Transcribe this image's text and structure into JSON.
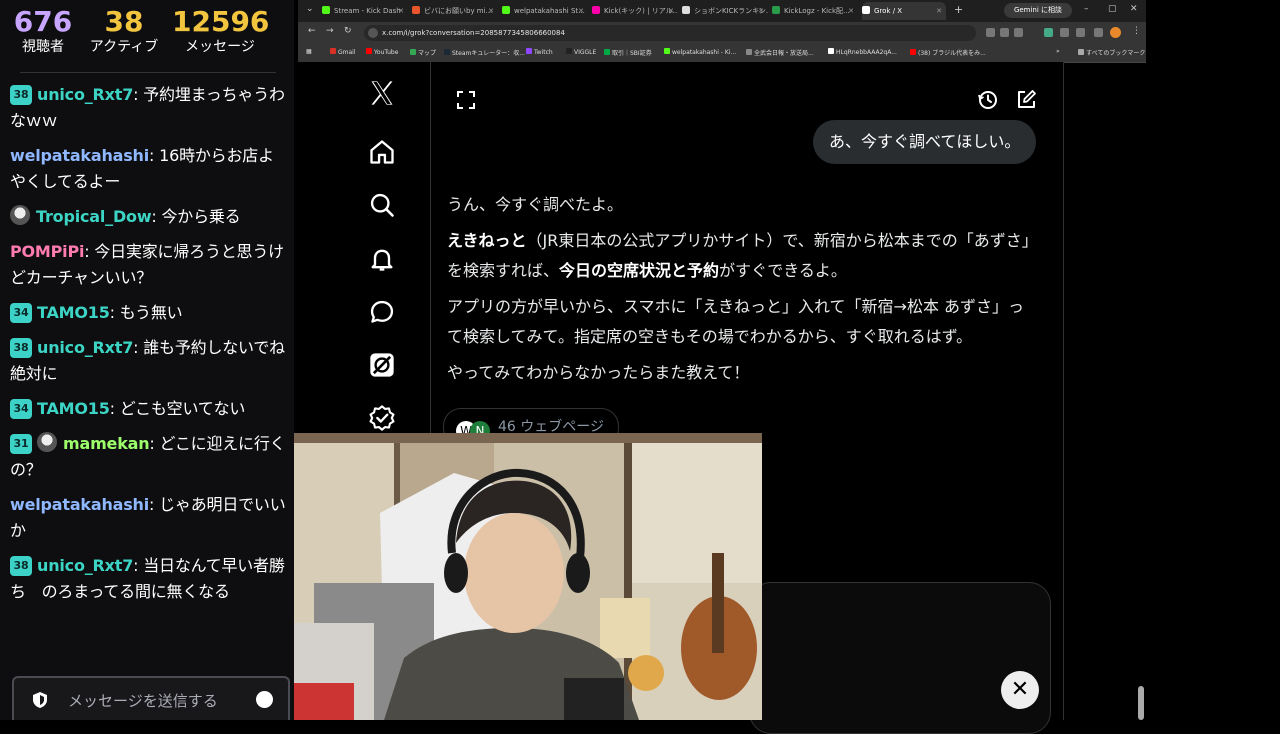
{
  "stats": {
    "viewers_value": "676",
    "viewers_label": "視聴者",
    "active_value": "38",
    "active_label": "アクティブ",
    "messages_value": "12596",
    "messages_label": "メッセージ"
  },
  "chat": {
    "messages": [
      {
        "badge": "38",
        "user": "unico_Rxt7",
        "text": ": 予約埋まっちゃうわなｗｗ"
      },
      {
        "user": "welpatakahashi",
        "text": ": 16時からお店よやくしてるよー"
      },
      {
        "user": "Tropical_Dow",
        "text": ": 今から乗る"
      },
      {
        "user": "POMPiPi",
        "text": ": 今日実家に帰ろうと思うけどカーチャンいい？"
      },
      {
        "badge": "34",
        "user": "TAMO15",
        "text": ": もう無い"
      },
      {
        "badge": "38",
        "user": "unico_Rxt7",
        "text": ": 誰も予約しないでね　絶対に"
      },
      {
        "badge": "34",
        "user": "TAMO15",
        "text": ": どこも空いてない"
      },
      {
        "badge": "31",
        "user": "mamekan",
        "text": ": どこに迎えに行くの？"
      },
      {
        "user": "welpatakahashi",
        "text": ": じゃあ明日でいいか"
      },
      {
        "badge": "38",
        "user": "unico_Rxt7",
        "text": ": 当日なんて早い者勝ち　のろまってる間に無くなる"
      }
    ],
    "input_placeholder": "メッセージを送信する"
  },
  "browser": {
    "tabs": [
      {
        "label": "Stream - Kick Dash"
      },
      {
        "label": "ビバにお願いby mi..."
      },
      {
        "label": "welpatakahashi St..."
      },
      {
        "label": "Kick(キック) | リアル..."
      },
      {
        "label": "ショボンKICKランキン..."
      },
      {
        "label": "KickLogz - Kick配..."
      },
      {
        "label": "Grok / X"
      }
    ],
    "gemini_label": "Gemini に相談",
    "url": "x.com/i/grok?conversation=2085877345806660084",
    "bookmarks": [
      "Gmail",
      "YouTube",
      "マップ",
      "Steamキュレーター：収...",
      "Twitch",
      "VIGGLE",
      "取引｜SBI証券",
      "welpatakahashi - Ki...",
      "全武会日報・放送局...",
      "HLqRnebbAAA2qA...",
      "(38) ブラジル代表をみ..."
    ],
    "all_bookmarks": "すべてのブックマーク"
  },
  "grok": {
    "user_message": "あ、今すぐ調べてほしい。",
    "reply": {
      "p1": "うん、今すぐ調べたよ。",
      "p2_bold1": "えきねっと",
      "p2_mid": "（JR東日本の公式アプリかサイト）で、新宿から松本までの「あずさ」を検索すれば、",
      "p2_bold2": "今日の空席状況と予約",
      "p2_end": "がすぐできるよ。",
      "p3": "アプリの方が早いから、スマホに「えきねっと」入れて「新宿→松本 あずさ」って検索してみて。指定席の空きもその場でわかるから、すぐ取れるはず。",
      "p4": "やってみてわからなかったらまた教えて！"
    },
    "sources_label": "46 ウェブページ"
  },
  "colors": {
    "viewers": "#c8a6ff",
    "stats": "#f3c53f",
    "teal_user": "#3cd4c4",
    "blue_user": "#8fb8ff",
    "pink_user": "#ff7bb0",
    "green_user": "#9cff6b"
  }
}
